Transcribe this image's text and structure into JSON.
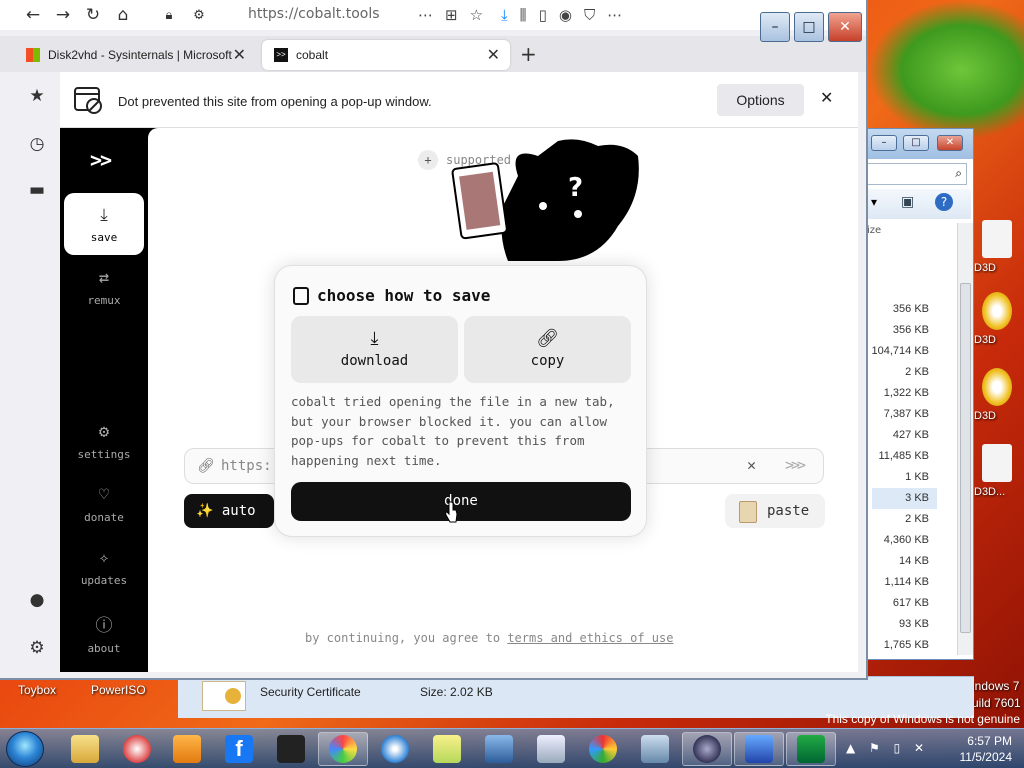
{
  "browser": {
    "url": "https://cobalt.tools",
    "tabs": [
      {
        "label": "Disk2vhd - Sysinternals | Microsoft",
        "active": false
      },
      {
        "label": "cobalt",
        "active": true
      }
    ],
    "notification": {
      "text": "Dot prevented this site from opening a pop-up window.",
      "options_label": "Options"
    }
  },
  "cobalt": {
    "logo": ">>",
    "nav": [
      {
        "label": "save",
        "icon": "download-icon",
        "active": true
      },
      {
        "label": "remux",
        "icon": "remux-icon",
        "active": false
      },
      {
        "label": "settings",
        "icon": "gear-icon",
        "active": false
      },
      {
        "label": "donate",
        "icon": "heart-icon",
        "active": false
      },
      {
        "label": "updates",
        "icon": "sparkle-icon",
        "active": false
      },
      {
        "label": "about",
        "icon": "info-icon",
        "active": false
      }
    ],
    "supported_label": "supported",
    "input_placeholder": "https:",
    "auto_label": "auto",
    "paste_label": "paste",
    "terms_prefix": "by continuing, you agree to",
    "terms_link": "terms and ethics of use"
  },
  "modal": {
    "title": "choose how to save",
    "download_label": "download",
    "copy_label": "copy",
    "description": "cobalt tried opening the file in a new tab, but your browser blocked it. you can allow pop-ups for cobalt to prevent this from happening next time.",
    "done_label": "done"
  },
  "explorer": {
    "col_header": "ize",
    "sizes": [
      "356 KB",
      "356 KB",
      "104,714 KB",
      "2 KB",
      "1,322 KB",
      "7,387 KB",
      "427 KB",
      "11,485 KB",
      "1 KB",
      "3 KB",
      "2 KB",
      "4,360 KB",
      "14 KB",
      "1,114 KB",
      "617 KB",
      "93 KB",
      "1,765 KB"
    ],
    "details_name": "Security Certificate",
    "details_size": "Size: 2.02 KB"
  },
  "desktop": {
    "labels": [
      "Toybox",
      "PowerISO",
      "D3D",
      "D3D",
      "D3D",
      "D3D..."
    ],
    "windows_text": [
      "indows 7",
      "uild 7601"
    ],
    "genuine": "This copy of Windows is not genuine"
  },
  "taskbar": {
    "time": "6:57 PM",
    "date": "11/5/2024"
  },
  "colors": {
    "accent": "#111111",
    "sidebar": "#000000",
    "notif_bg": "#ffffff"
  }
}
